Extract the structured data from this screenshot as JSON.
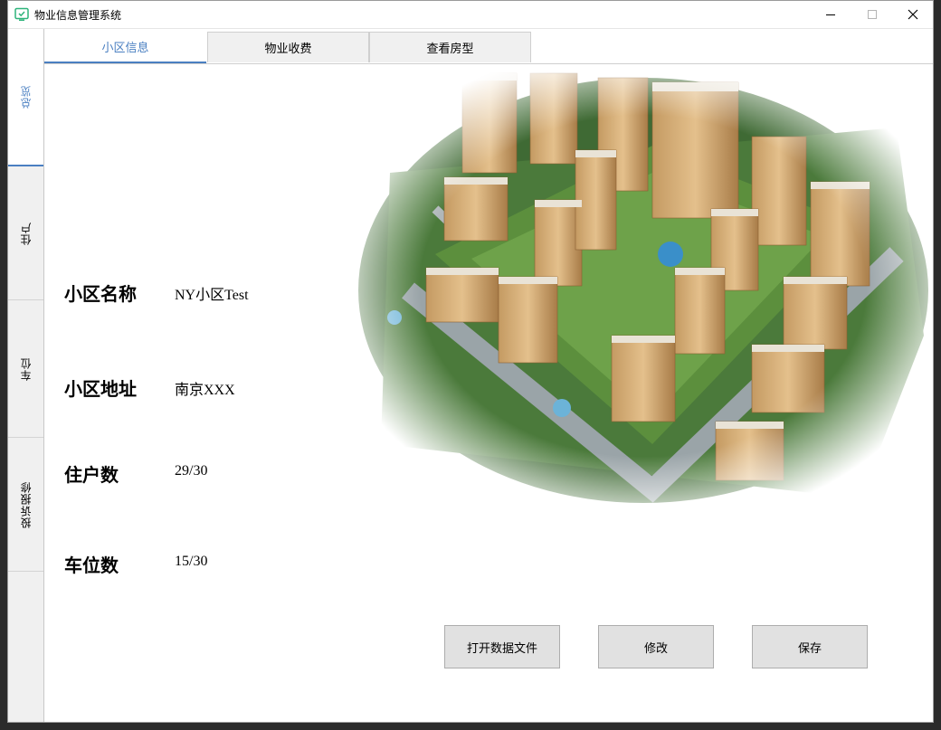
{
  "window": {
    "title": "物业信息管理系统"
  },
  "sidebar": {
    "items": [
      {
        "label": "总览"
      },
      {
        "label": "住户"
      },
      {
        "label": "车位"
      },
      {
        "label": "投诉报修"
      }
    ]
  },
  "tabs": [
    {
      "label": "小区信息"
    },
    {
      "label": "物业收费"
    },
    {
      "label": "查看房型"
    }
  ],
  "info": {
    "name_label": "小区名称",
    "name_value": "NY小区Test",
    "address_label": "小区地址",
    "address_value": "南京XXX",
    "residents_label": "住户数",
    "residents_value": "29/30",
    "parking_label": "车位数",
    "parking_value": "15/30"
  },
  "buttons": {
    "open": "打开数据文件",
    "edit": "修改",
    "save": "保存"
  },
  "colors": {
    "accent": "#4a7fc1",
    "app_icon": "#2db37a"
  }
}
